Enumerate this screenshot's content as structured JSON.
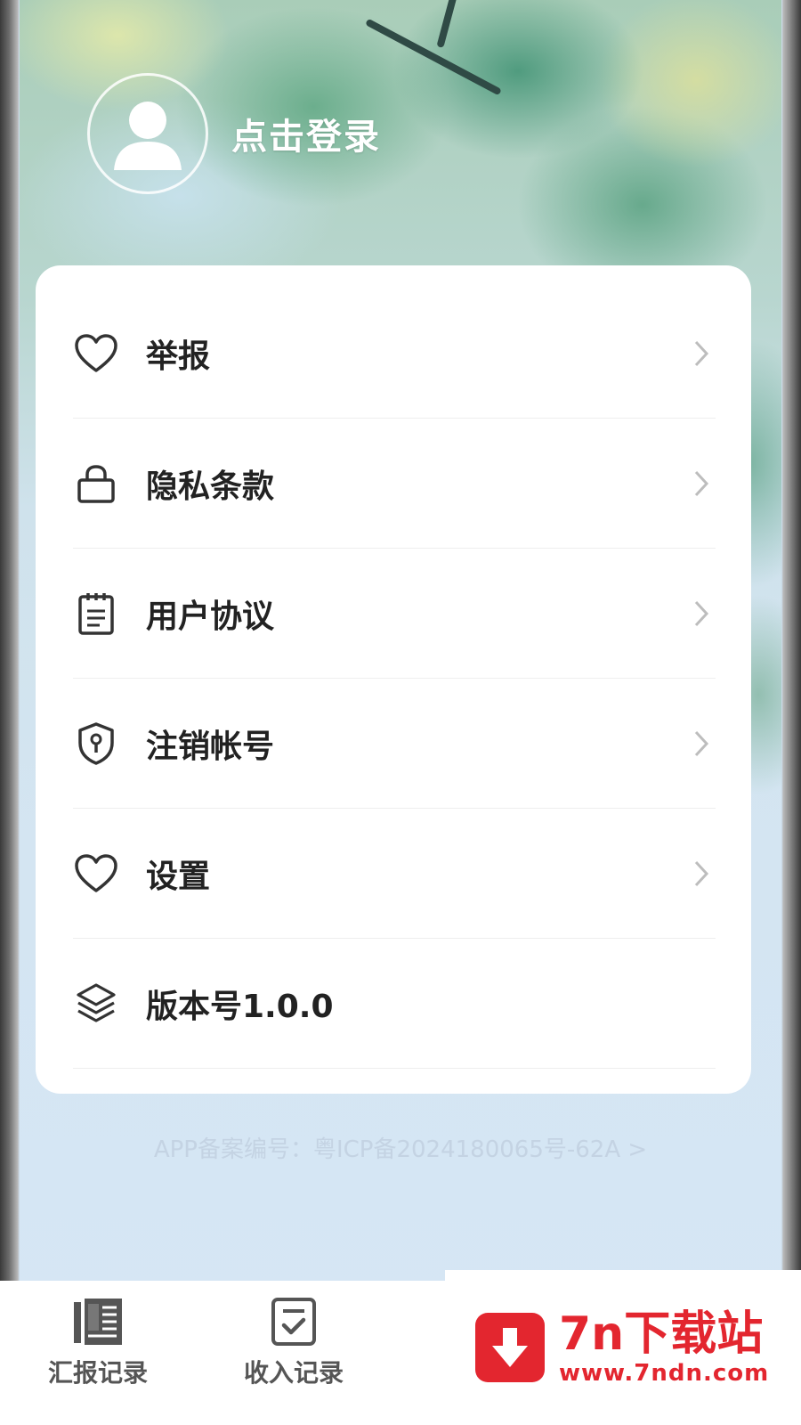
{
  "header": {
    "login_label": "点击登录"
  },
  "menu": {
    "items": [
      {
        "label": "举报",
        "icon": "heart-icon",
        "has_arrow": true
      },
      {
        "label": "隐私条款",
        "icon": "lock-icon",
        "has_arrow": true
      },
      {
        "label": "用户协议",
        "icon": "clipboard-icon",
        "has_arrow": true
      },
      {
        "label": "注销帐号",
        "icon": "shield-keyhole-icon",
        "has_arrow": true
      },
      {
        "label": "设置",
        "icon": "heart-icon",
        "has_arrow": true
      },
      {
        "label": "版本号1.0.0",
        "icon": "layers-icon",
        "has_arrow": false
      }
    ]
  },
  "footer": {
    "icp_text": "APP备案编号：粤ICP备2024180065号-62A >"
  },
  "tabbar": {
    "tabs": [
      {
        "label": "汇报记录",
        "icon": "report-book-icon"
      },
      {
        "label": "收入记录",
        "icon": "checklist-icon"
      }
    ]
  },
  "watermark": {
    "title": "7n下载站",
    "url": "www.7ndn.com"
  },
  "colors": {
    "accent_red": "#e3262f",
    "text_dark": "#222222",
    "icp_text": "#c4d3e3"
  }
}
